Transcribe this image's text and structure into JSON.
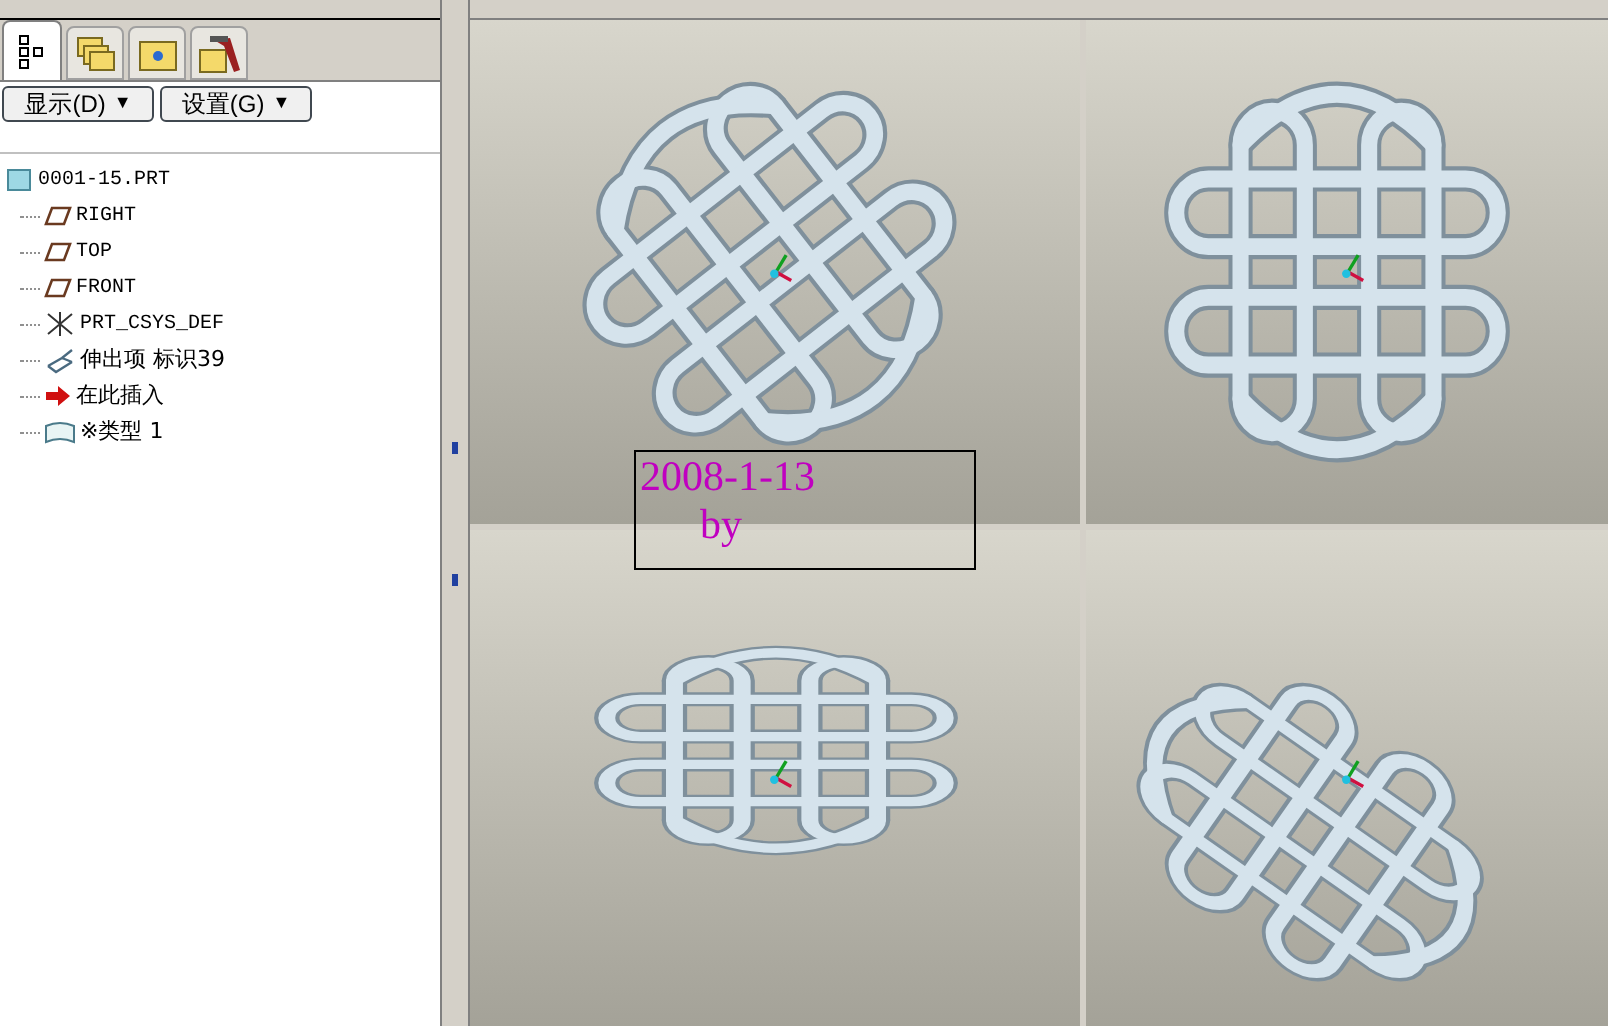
{
  "navigator_tabs": [
    {
      "kind": "tree",
      "selected": true
    },
    {
      "kind": "layers",
      "selected": false
    },
    {
      "kind": "folder",
      "selected": false
    },
    {
      "kind": "tools",
      "selected": false
    }
  ],
  "menu_buttons": [
    {
      "label": "显示(D)",
      "caret": "▼"
    },
    {
      "label": "设置(G)",
      "caret": "▼"
    }
  ],
  "model_tree": {
    "root": "0001-15.PRT",
    "children": [
      {
        "kind": "plane",
        "label": "RIGHT"
      },
      {
        "kind": "plane",
        "label": "TOP"
      },
      {
        "kind": "plane",
        "label": "FRONT"
      },
      {
        "kind": "csys",
        "label": "PRT_CSYS_DEF"
      },
      {
        "kind": "extrude",
        "label": "伸出项 标识39"
      },
      {
        "kind": "insert",
        "label": "在此插入"
      },
      {
        "kind": "surface",
        "label": "※类型 1"
      }
    ]
  },
  "viewports": [
    {
      "kind": "tilted"
    },
    {
      "kind": "top"
    },
    {
      "kind": "flat"
    },
    {
      "kind": "side"
    }
  ],
  "annotation": {
    "date": "2008-1-13",
    "by": "by"
  }
}
